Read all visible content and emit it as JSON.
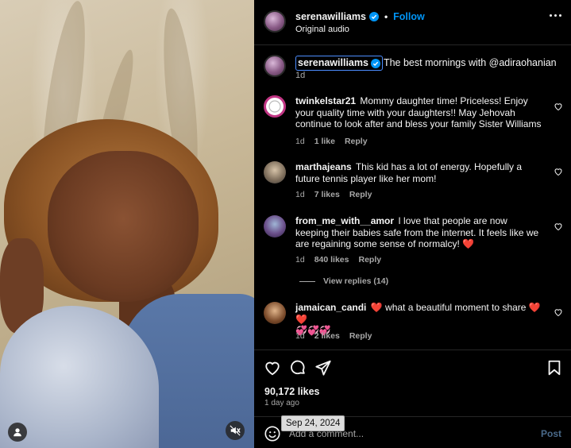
{
  "header": {
    "username": "serenawilliams",
    "follow_label": "Follow",
    "separator": "•",
    "subtitle": "Original audio"
  },
  "caption": {
    "username": "serenawilliams",
    "text": "The best mornings with @adiraohanian",
    "time": "1d"
  },
  "comments": [
    {
      "username": "twinkelstar21",
      "text": "Mommy daughter time! Priceless! Enjoy your quality time with your daughters!! May Jehovah continue to look after and bless your family Sister Williams",
      "time": "1d",
      "likes": "1 like",
      "reply": "Reply"
    },
    {
      "username": "marthajeans",
      "text": "This kid has a lot of energy. Hopefully a future tennis player like her mom!",
      "time": "1d",
      "likes": "7 likes",
      "reply": "Reply"
    },
    {
      "username": "from_me_with__amor",
      "text": "I love that people are now keeping their babies safe from the internet. It feels like we are regaining some sense of normalcy! ",
      "emoji": "❤️",
      "time": "1d",
      "likes": "840 likes",
      "reply": "Reply",
      "view_replies": "View replies (14)"
    },
    {
      "username": "jamaican_candi",
      "emoji_before": "❤️",
      "text": " what a beautiful moment to share ",
      "emoji_after": "❤️❤️",
      "emoji_line": "💞💞💞",
      "time": "1d",
      "likes": "2 likes",
      "reply": "Reply"
    }
  ],
  "post": {
    "likes": "90,172 likes",
    "ago": "1 day ago",
    "date_tooltip": "Sep 24, 2024"
  },
  "comment_box": {
    "placeholder": "Add a comment...",
    "post_label": "Post"
  },
  "icons": {
    "like": "heart-icon",
    "comment": "comment-icon",
    "share": "share-icon",
    "save": "bookmark-icon",
    "mute": "muted-speaker-icon",
    "user": "user-tag-icon",
    "emoji": "emoji-icon",
    "more": "more-options-icon"
  },
  "colors": {
    "background": "#000000",
    "text": "#f5f5f5",
    "secondary_text": "#a8a8a8",
    "follow": "#0095f6",
    "heart_emoji": "#ff3040",
    "divider": "#262626"
  }
}
